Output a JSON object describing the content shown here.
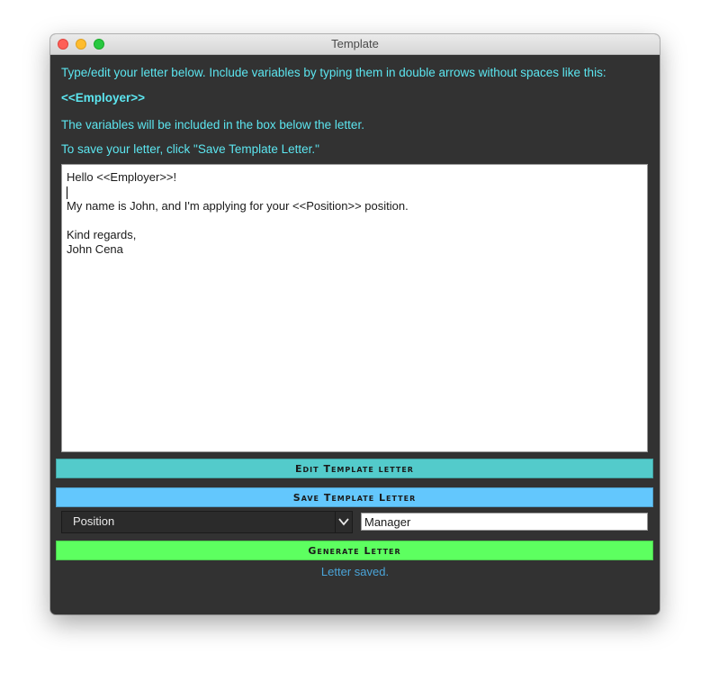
{
  "window": {
    "title": "Template"
  },
  "instructions": {
    "line1": "Type/edit your letter below. Include variables by typing them in double arrows without spaces like this:",
    "example": "<<Employer>>",
    "line2": "The variables will be included in the box below the letter.",
    "line3": "To save your letter, click \"Save Template Letter.\""
  },
  "letter": {
    "lines": [
      "Hello <<Employer>>!",
      "",
      "My name is John, and I'm applying for your <<Position>> position.",
      "",
      "Kind regards,",
      "John Cena"
    ]
  },
  "buttons": {
    "edit": "Edit Template letter",
    "save": "Save Template Letter",
    "generate": "Generate Letter"
  },
  "variable": {
    "selected": "Position",
    "value": "Manager"
  },
  "status": "Letter saved.",
  "colors": {
    "window_bg": "#323232",
    "info_text": "#5ce6f0",
    "edit_button": "#53cbcb",
    "save_button": "#63c7fd",
    "generate_button": "#5dff60",
    "status_text": "#4aa4d8"
  }
}
